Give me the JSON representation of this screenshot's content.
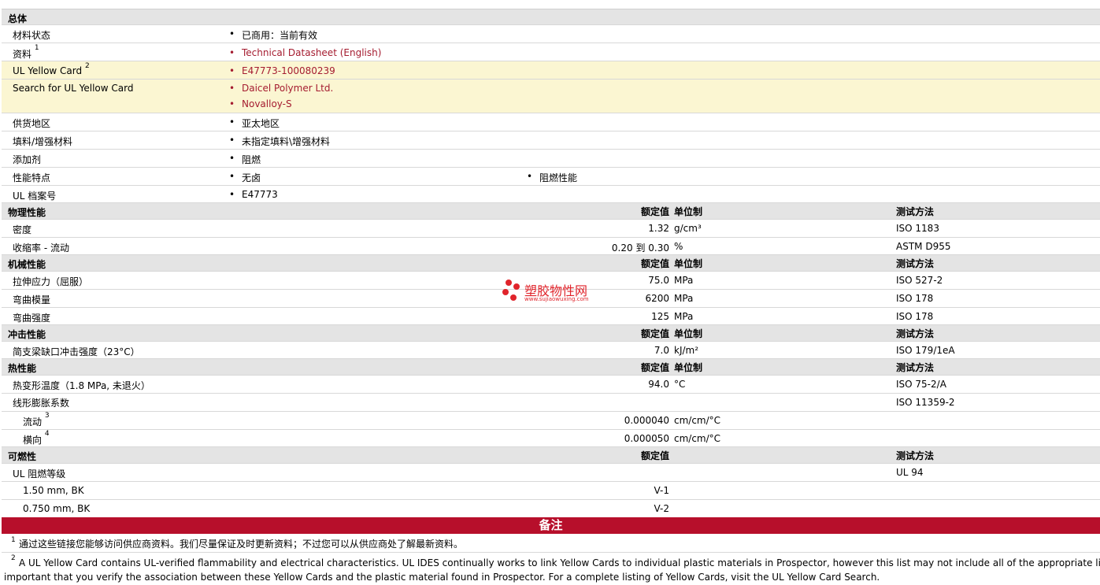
{
  "general": {
    "title": "总体",
    "rows": [
      {
        "label": "材料状态",
        "value": "已商用：当前有效"
      },
      {
        "label": "资料",
        "sup": "1",
        "value": "Technical Datasheet (English)"
      },
      {
        "label": "UL Yellow Card",
        "sup": "2",
        "value": "E47773-100080239"
      },
      {
        "label": "Search for UL Yellow Card",
        "values": [
          "Daicel Polymer Ltd.",
          "Novalloy-S"
        ]
      },
      {
        "label": "供货地区",
        "value": "亚太地区"
      },
      {
        "label": "填料/增强材料",
        "value": "未指定填料\\增强材料"
      },
      {
        "label": "添加剂",
        "value": "阻燃"
      },
      {
        "label": "性能特点",
        "value": "无卤",
        "value2": "阻燃性能"
      },
      {
        "label": "UL 档案号",
        "value": "E47773"
      }
    ]
  },
  "headers": {
    "rated": "额定值",
    "unit": "单位制",
    "method": "测试方法"
  },
  "physical": {
    "title": "物理性能",
    "rows": [
      {
        "label": "密度",
        "value": "1.32",
        "unit": "g/cm³",
        "method": "ISO 1183"
      },
      {
        "label": "收缩率 - 流动",
        "value": "0.20 到  0.30",
        "unit": "%",
        "method": "ASTM D955"
      }
    ]
  },
  "mechanical": {
    "title": "机械性能",
    "rows": [
      {
        "label": "拉伸应力（屈服）",
        "value": "75.0",
        "unit": "MPa",
        "method": "ISO 527-2"
      },
      {
        "label": "弯曲模量",
        "value": "6200",
        "unit": "MPa",
        "method": "ISO 178"
      },
      {
        "label": "弯曲强度",
        "value": "125",
        "unit": "MPa",
        "method": "ISO 178"
      }
    ]
  },
  "impact": {
    "title": "冲击性能",
    "rows": [
      {
        "label": "简支梁缺口冲击强度（23°C）",
        "value": "7.0",
        "unit": "kJ/m²",
        "method": "ISO 179/1eA"
      }
    ]
  },
  "thermal": {
    "title": "热性能",
    "rows": [
      {
        "label": "热变形温度（1.8 MPa, 未退火）",
        "value": "94.0",
        "unit": "°C",
        "method": "ISO 75-2/A"
      },
      {
        "label": "线形膨胀系数",
        "value": "",
        "unit": "",
        "method": "ISO 11359-2"
      },
      {
        "label": "流动",
        "sup": "3",
        "value": "0.000040",
        "unit": "cm/cm/°C",
        "method": ""
      },
      {
        "label": "横向",
        "sup": "4",
        "value": "0.000050",
        "unit": "cm/cm/°C",
        "method": ""
      }
    ]
  },
  "flammability": {
    "title": "可燃性",
    "rows": [
      {
        "label": "UL 阻燃等级",
        "value": "",
        "method": "UL 94"
      },
      {
        "label": "1.50 mm, BK",
        "value": "V-1",
        "method": ""
      },
      {
        "label": "0.750 mm, BK",
        "value": "V-2",
        "method": ""
      }
    ]
  },
  "notes": {
    "title": "备注",
    "n1": "通过这些链接您能够访问供应商资料。我们尽量保证及时更新资料；不过您可以从供应商处了解最新资料。",
    "n2a": "A UL Yellow Card contains UL-verified flammability and electrical characteristics. UL IDES continually works to link Yellow Cards to individual plastic materials in Prospector, however this list may not include all of the appropriate links. It is",
    "n2b": "important that you verify the association between these Yellow Cards and the plastic material found in Prospector. For a complete listing of Yellow Cards, visit the UL Yellow Card Search.",
    "s1": "1",
    "s2": "2"
  },
  "watermark": {
    "name": "塑胶物性网",
    "url": "www.sujiaowuxing.com"
  },
  "colors": {
    "link": "#a51c30",
    "notes_bar": "#b70f2b",
    "highlight": "#fbf6d2",
    "section": "#e4e4e4"
  }
}
